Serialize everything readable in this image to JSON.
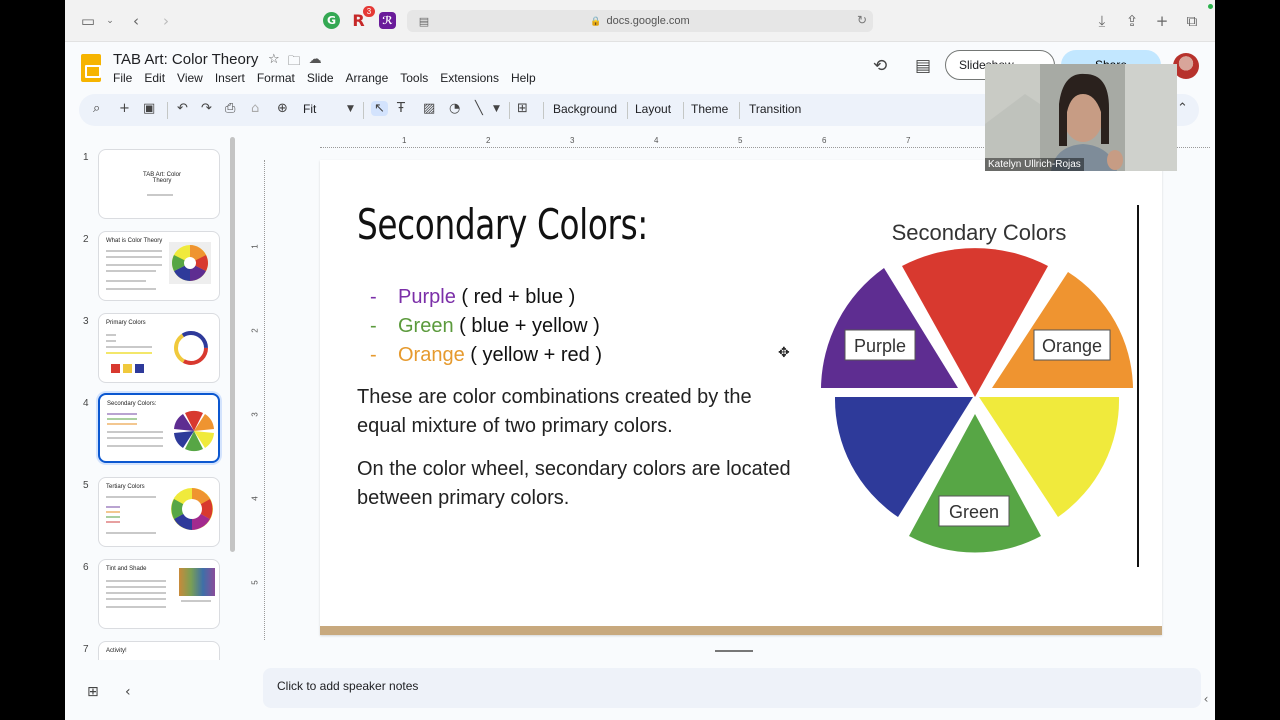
{
  "browser": {
    "url": "docs.google.com",
    "extensions": [
      {
        "label": "G",
        "color": "#34a853",
        "name": "grammarly"
      },
      {
        "label": "R",
        "color": "#c62828",
        "name": "r"
      },
      {
        "label": "ℛ",
        "color": "#6a1b9a",
        "name": "r-script"
      }
    ],
    "badge": "3"
  },
  "doc": {
    "title": "TAB Art: Color Theory",
    "menu": [
      "File",
      "Edit",
      "View",
      "Insert",
      "Format",
      "Slide",
      "Arrange",
      "Tools",
      "Extensions",
      "Help"
    ],
    "slideshow_label": "Slideshow",
    "share_label": "Share"
  },
  "toolbar": {
    "zoom": "Fit",
    "background": "Background",
    "layout": "Layout",
    "theme": "Theme",
    "transition": "Transition"
  },
  "rulers": {
    "h": [
      "1",
      "2",
      "3",
      "4",
      "5",
      "6",
      "7"
    ],
    "v": [
      "1",
      "2",
      "3",
      "4",
      "5"
    ]
  },
  "filmstrip": [
    {
      "num": "1",
      "title": "TAB Art: Color Theory"
    },
    {
      "num": "2",
      "title": "What is Color Theory"
    },
    {
      "num": "3",
      "title": "Primary Colors"
    },
    {
      "num": "4",
      "title": "Secondary Colors:"
    },
    {
      "num": "5",
      "title": "Tertiary Colors"
    },
    {
      "num": "6",
      "title": "Tint and Shade"
    },
    {
      "num": "7",
      "title": "Activity!"
    }
  ],
  "slide": {
    "title": "Secondary Colors:",
    "bullets": [
      {
        "dash": "-",
        "color_word": "Purple",
        "rest": " ( red + blue )",
        "color": "#7b2fa8"
      },
      {
        "dash": "-",
        "color_word": "Green",
        "rest": " ( blue + yellow )",
        "color": "#5b9a3c"
      },
      {
        "dash": "-",
        "color_word": "Orange",
        "rest": " ( yellow + red )",
        "color": "#e69a2e"
      }
    ],
    "para1": "These are color combinations created by the equal mixture of two primary colors.",
    "para2": "On the color wheel, secondary colors are located between primary colors.",
    "wheel": {
      "title": "Secondary Colors",
      "labels": {
        "purple": "Purple",
        "orange": "Orange",
        "green": "Green"
      },
      "colors": {
        "red": "#d8392f",
        "orange": "#ef9430",
        "yellow": "#f0ea3c",
        "green": "#57a645",
        "blue": "#2e3a9a",
        "purple": "#5e2d91"
      }
    }
  },
  "notes": {
    "placeholder": "Click to add speaker notes"
  },
  "webcam": {
    "name": "Katelyn Ullrich-Rojas"
  }
}
